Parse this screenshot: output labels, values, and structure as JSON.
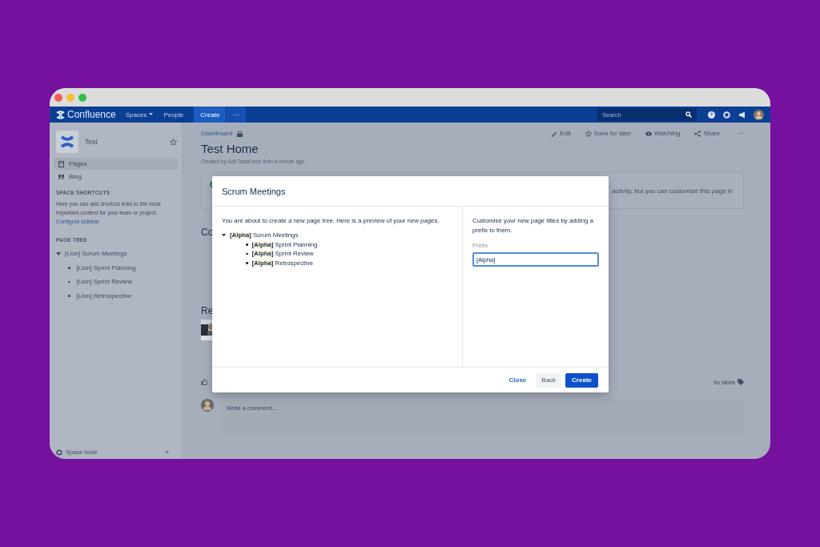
{
  "top_nav": {
    "product": "Confluence",
    "menus": [
      {
        "label": "Spaces",
        "dropdown": true
      },
      {
        "label": "People",
        "dropdown": false
      }
    ],
    "create": "Create",
    "more": "···",
    "search": {
      "placeholder": "Search"
    }
  },
  "sidebar": {
    "space_name": "Test",
    "items": [
      {
        "label": "Pages",
        "selected": true
      },
      {
        "label": "Blog",
        "selected": false
      }
    ],
    "shortcuts_heading": "SPACE SHORTCUTS",
    "shortcuts_text": "Here you can add shortcut links to the most important content for your team or project.",
    "configure_link": "Configure sidebar",
    "tree_heading": "PAGE TREE",
    "tree": [
      {
        "label": "[Lion] Scrum Meetings",
        "expanded": true,
        "children": [
          {
            "label": "[Lion] Sprint Planning"
          },
          {
            "label": "[Lion] Sprint Review"
          },
          {
            "label": "[Lion] Retrospective"
          }
        ]
      }
    ],
    "space_tools": "Space tools",
    "collapse": "«"
  },
  "page": {
    "breadcrumb": "Dashboard",
    "actions": [
      {
        "label": "Edit",
        "kind": "edit"
      },
      {
        "label": "Save for later",
        "kind": "save"
      },
      {
        "label": "Watching",
        "kind": "watch"
      },
      {
        "label": "Share",
        "kind": "share"
      }
    ],
    "more": "···",
    "title": "Test Home",
    "byline": "Created by Adil Tassli less than a minute ago",
    "banner_text": "activity, but you can customize this page in",
    "heading_1": "Co",
    "heading_2": "Re",
    "labels": "No labels",
    "comment_placeholder": "Write a comment..."
  },
  "dialog": {
    "title": "Scrum Meetings",
    "intro": "You are about to create a new page tree. Here is a preview of your new pages.",
    "preview": [
      {
        "label": "**[Alpha]** Scrum Meetings",
        "children": [
          {
            "label": "**[Alpha]** Sprint Planning"
          },
          {
            "label": "**[Alpha]** Sprint Review"
          },
          {
            "label": "**[Alpha]** Retrospective"
          }
        ]
      }
    ],
    "help": "Customise your new page titles by adding a prefix to them.",
    "prefix_label": "Prefix",
    "prefix_value": "[Alpha] ",
    "buttons": [
      {
        "label": "Close",
        "kind": "link"
      },
      {
        "label": "Back",
        "kind": "secondary"
      },
      {
        "label": "Create",
        "kind": "primary"
      }
    ]
  }
}
